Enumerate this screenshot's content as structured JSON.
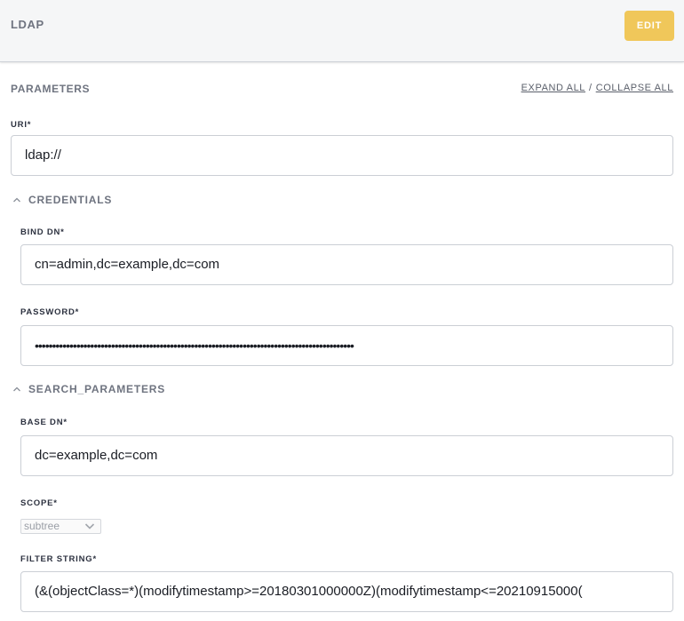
{
  "header": {
    "title": "LDAP",
    "edit_label": "EDIT"
  },
  "parameters": {
    "title": "PARAMETERS",
    "expand_all": "EXPAND ALL",
    "separator": "/",
    "collapse_all": "COLLAPSE ALL"
  },
  "uri": {
    "label": "URI*",
    "value": "ldap://"
  },
  "credentials": {
    "title": "CREDENTIALS",
    "bind_dn": {
      "label": "BIND DN*",
      "value": "cn=admin,dc=example,dc=com"
    },
    "password": {
      "label": "PASSWORD*",
      "value": "••••••••••••••••••••••••••••••••••••••••••••••••••••••••••••••••••••••••••••••••••••••••••••"
    }
  },
  "search_parameters": {
    "title": "SEARCH_PARAMETERS",
    "base_dn": {
      "label": "BASE DN*",
      "value": "dc=example,dc=com"
    },
    "scope": {
      "label": "SCOPE*",
      "selected": "subtree"
    },
    "filter": {
      "label": "FILTER STRING*",
      "value": "(&(objectClass=*)(modifytimestamp>=20180301000000Z)(modifytimestamp<=20210915000("
    }
  },
  "colors": {
    "accent": "#f0c75a",
    "header_bg": "#f5f6f7",
    "muted_text": "#6f7480"
  }
}
